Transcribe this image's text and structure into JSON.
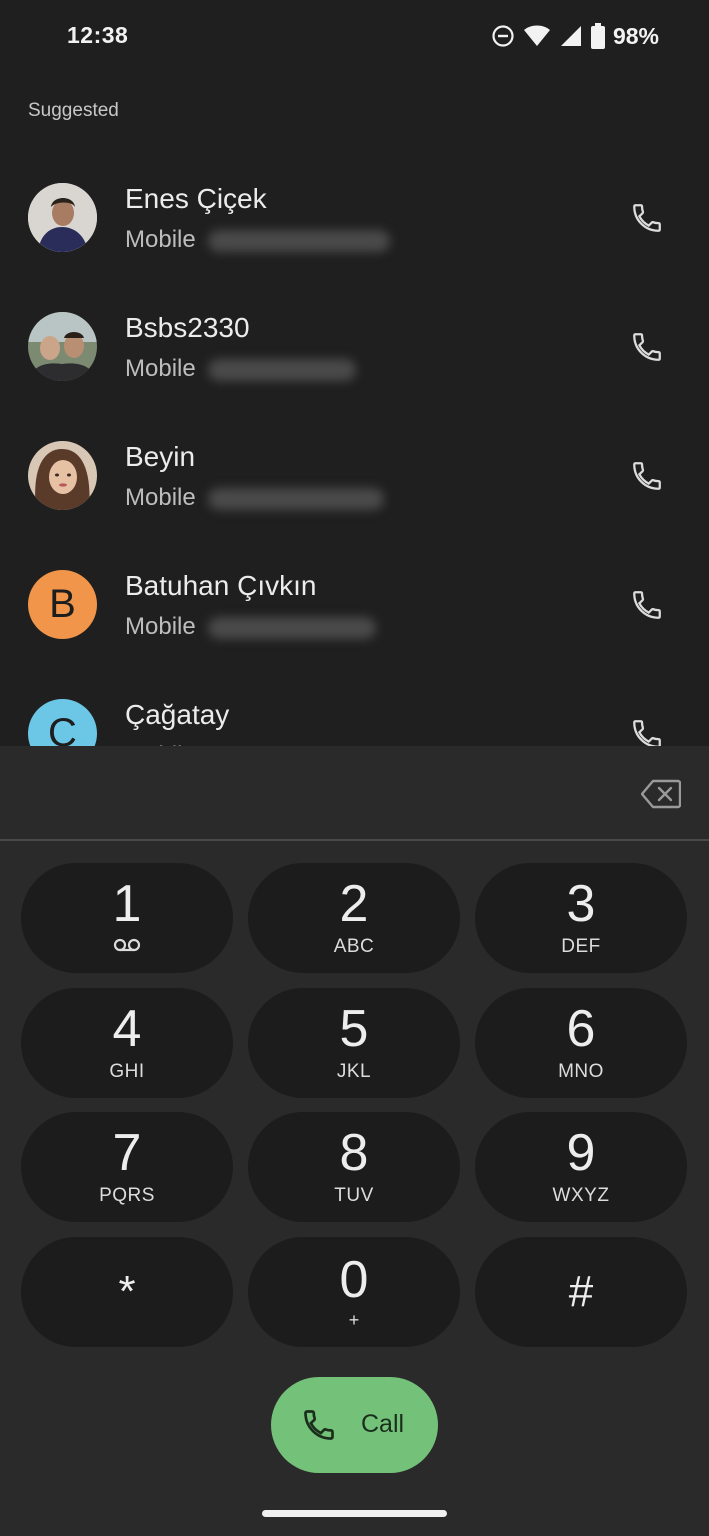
{
  "status_bar": {
    "time": "12:38",
    "battery": "98%",
    "icons": [
      "do-not-disturb-icon",
      "wifi-icon",
      "cell-signal-icon",
      "battery-icon"
    ]
  },
  "suggested": {
    "header": "Suggested",
    "contacts": [
      {
        "name": "Enes Çiçek",
        "type": "Mobile",
        "avatar": "photo",
        "avatar_letter": ""
      },
      {
        "name": "Bsbs2330",
        "type": "Mobile",
        "avatar": "photo",
        "avatar_letter": ""
      },
      {
        "name": "Beyin",
        "type": "Mobile",
        "avatar": "photo",
        "avatar_letter": ""
      },
      {
        "name": "Batuhan Çıvkın",
        "type": "Mobile",
        "avatar": "letter",
        "avatar_letter": "B",
        "avatar_color": "#f0954a"
      },
      {
        "name": "Çağatay",
        "type": "Mobile",
        "avatar": "letter",
        "avatar_letter": "Ç",
        "avatar_color": "#6cc6e6"
      }
    ]
  },
  "dialpad": {
    "input_value": "",
    "keys": [
      {
        "digit": "1",
        "letters": "",
        "voicemail": true
      },
      {
        "digit": "2",
        "letters": "ABC"
      },
      {
        "digit": "3",
        "letters": "DEF"
      },
      {
        "digit": "4",
        "letters": "GHI"
      },
      {
        "digit": "5",
        "letters": "JKL"
      },
      {
        "digit": "6",
        "letters": "MNO"
      },
      {
        "digit": "7",
        "letters": "PQRS"
      },
      {
        "digit": "8",
        "letters": "TUV"
      },
      {
        "digit": "9",
        "letters": "WXYZ"
      },
      {
        "digit": "*",
        "letters": ""
      },
      {
        "digit": "0",
        "letters": "+"
      },
      {
        "digit": "#",
        "letters": ""
      }
    ],
    "call_label": "Call",
    "call_color": "#74c27a"
  }
}
